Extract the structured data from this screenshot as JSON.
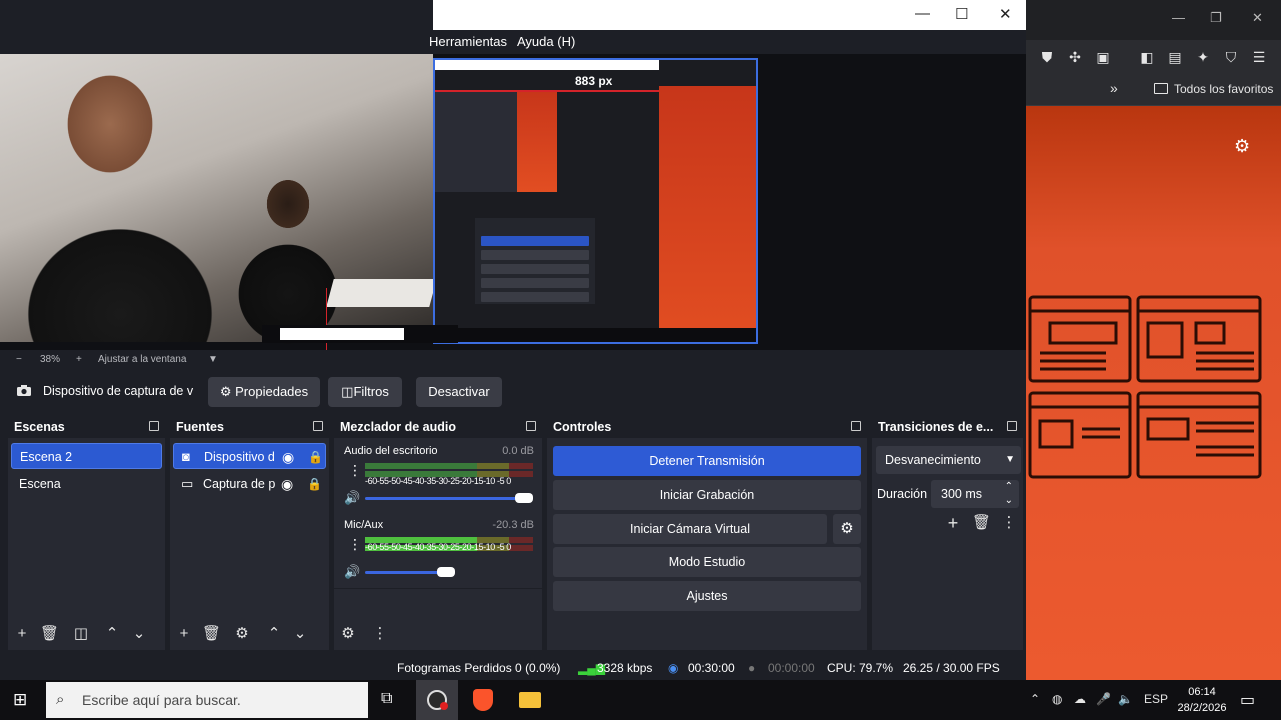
{
  "browser": {
    "bookmarks_label": "Todos los favoritos"
  },
  "obs": {
    "menu": [
      "Herramientas",
      "Ayuda (H)"
    ],
    "preview": {
      "nested_px_label": "883 px"
    },
    "zoom_bar": {
      "minus": "−",
      "zoom": "38%",
      "plus": "+",
      "fit_label": "Ajustar a la ventana"
    },
    "source_bar": {
      "source_name": "Dispositivo de captura de v",
      "properties": "Propiedades",
      "filters": "Filtros",
      "deactivate": "Desactivar"
    },
    "scenes": {
      "title": "Escenas",
      "items": [
        "Escena 2",
        "Escena"
      ]
    },
    "sources": {
      "title": "Fuentes",
      "items": [
        "Dispositivo d",
        "Captura de p"
      ]
    },
    "mixer": {
      "title": "Mezclador de audio",
      "channels": [
        {
          "name": "Audio del escritorio",
          "db": "0.0 dB",
          "ticks": "-60-55-50-45-40-35-30-25-20-15-10 -5  0",
          "volume": 1.0
        },
        {
          "name": "Mic/Aux",
          "db": "-20.3 dB",
          "ticks": "-60-55-50-45-40-35-30-25-20-15-10 -5  0",
          "volume": 0.6
        }
      ]
    },
    "controls": {
      "title": "Controles",
      "stop_stream": "Detener Transmisión",
      "start_record": "Iniciar Grabación",
      "start_vcam": "Iniciar Cámara Virtual",
      "studio_mode": "Modo Estudio",
      "settings": "Ajustes"
    },
    "transitions": {
      "title": "Transiciones de e...",
      "selected": "Desvanecimiento",
      "duration_label": "Duración",
      "duration_value": "300 ms"
    },
    "status": {
      "dropped": "Fotogramas Perdidos 0 (0.0%)",
      "kbps": "3328 kbps",
      "stream_time": "00:30:00",
      "rec_time": "00:00:00",
      "cpu": "CPU: 79.7%",
      "fps": "26.25 / 30.00 FPS"
    }
  },
  "taskbar": {
    "search_placeholder": "Escribe aquí para buscar.",
    "lang": "ESP",
    "time": "06:14",
    "date": "28/2/2026"
  },
  "colors": {
    "accent": "#2e5bd5",
    "panel": "#272932",
    "orange": "#ec5a2f"
  }
}
